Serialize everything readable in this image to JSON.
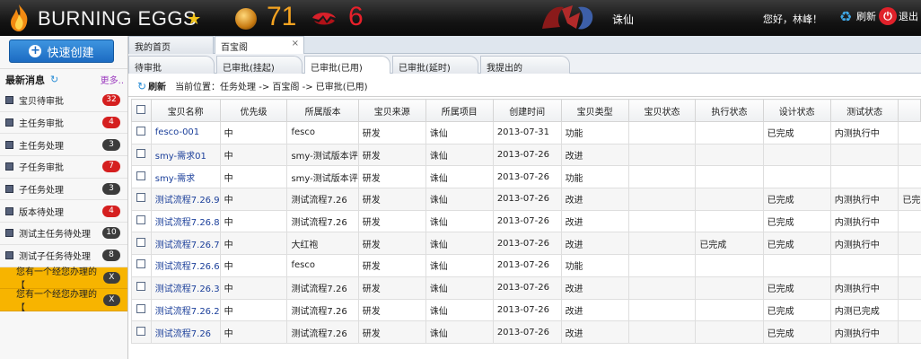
{
  "header": {
    "brand": "BURNING EGGS",
    "count_eggs": "71",
    "count_broken": "6",
    "game_name": "诛仙",
    "greeting": "您好，林峰！",
    "refresh_label": "刷新",
    "logout_label": "退出",
    "colors": {
      "eggs": "#f5a320",
      "broken": "#e8202a",
      "star": "#f3c51a"
    }
  },
  "sidebar": {
    "quick_create": "快速创建",
    "section_title": "最新消息",
    "more_label": "更多..",
    "items": [
      {
        "label": "宝贝待审批",
        "badge": "32",
        "color": "red"
      },
      {
        "label": "主任务审批",
        "badge": "4",
        "color": "red"
      },
      {
        "label": "主任务处理",
        "badge": "3",
        "color": "dark"
      },
      {
        "label": "子任务审批",
        "badge": "7",
        "color": "red"
      },
      {
        "label": "子任务处理",
        "badge": "3",
        "color": "dark"
      },
      {
        "label": "版本待处理",
        "badge": "4",
        "color": "red"
      },
      {
        "label": "测试主任务待处理",
        "badge": "10",
        "color": "dark"
      },
      {
        "label": "测试子任务待处理",
        "badge": "8",
        "color": "dark"
      }
    ],
    "notices": [
      {
        "label": "您有一个经您办理的【",
        "badge": "X"
      },
      {
        "label": "您有一个经您办理的【",
        "badge": "X"
      }
    ]
  },
  "tabs": [
    {
      "label": "我的首页"
    },
    {
      "label": "百宝阁",
      "close": "×"
    }
  ],
  "subtabs": [
    {
      "label": "待审批"
    },
    {
      "label": "已审批(挂起)"
    },
    {
      "label": "已审批(已用)"
    },
    {
      "label": "已审批(延时)"
    },
    {
      "label": "我提出的"
    }
  ],
  "toolbar": {
    "refresh": "刷新",
    "breadcrumb": "当前位置：任务处理 -> 百宝阁 -> 已审批(已用)"
  },
  "table": {
    "columns": [
      "宝贝名称",
      "优先级",
      "所属版本",
      "宝贝来源",
      "所属项目",
      "创建时间",
      "宝贝类型",
      "宝贝状态",
      "执行状态",
      "设计状态",
      "测试状态",
      ""
    ],
    "rows": [
      [
        "fesco-001",
        "中",
        "fesco",
        "研发",
        "诛仙",
        "2013-07-31",
        "功能",
        "",
        "",
        "已完成",
        "内测执行中",
        ""
      ],
      [
        "smy-需求01",
        "中",
        "smy-测试版本评",
        "研发",
        "诛仙",
        "2013-07-26",
        "改进",
        "",
        "",
        "",
        "",
        ""
      ],
      [
        "smy-需求",
        "中",
        "smy-测试版本评",
        "研发",
        "诛仙",
        "2013-07-26",
        "功能",
        "",
        "",
        "",
        "",
        ""
      ],
      [
        "测试流程7.26.9",
        "中",
        "测试流程7.26",
        "研发",
        "诛仙",
        "2013-07-26",
        "改进",
        "",
        "",
        "已完成",
        "内测执行中",
        "已完"
      ],
      [
        "测试流程7.26.8",
        "中",
        "测试流程7.26",
        "研发",
        "诛仙",
        "2013-07-26",
        "改进",
        "",
        "",
        "已完成",
        "内测执行中",
        ""
      ],
      [
        "测试流程7.26.7",
        "中",
        "大红袍",
        "研发",
        "诛仙",
        "2013-07-26",
        "改进",
        "",
        "已完成",
        "已完成",
        "内测执行中",
        ""
      ],
      [
        "测试流程7.26.6",
        "中",
        "fesco",
        "研发",
        "诛仙",
        "2013-07-26",
        "功能",
        "",
        "",
        "",
        "",
        ""
      ],
      [
        "测试流程7.26.3",
        "中",
        "测试流程7.26",
        "研发",
        "诛仙",
        "2013-07-26",
        "改进",
        "",
        "",
        "已完成",
        "内测执行中",
        ""
      ],
      [
        "测试流程7.26.2",
        "中",
        "测试流程7.26",
        "研发",
        "诛仙",
        "2013-07-26",
        "改进",
        "",
        "",
        "已完成",
        "内测已完成",
        ""
      ],
      [
        "测试流程7.26",
        "中",
        "测试流程7.26",
        "研发",
        "诛仙",
        "2013-07-26",
        "改进",
        "",
        "",
        "已完成",
        "内测执行中",
        ""
      ]
    ]
  }
}
